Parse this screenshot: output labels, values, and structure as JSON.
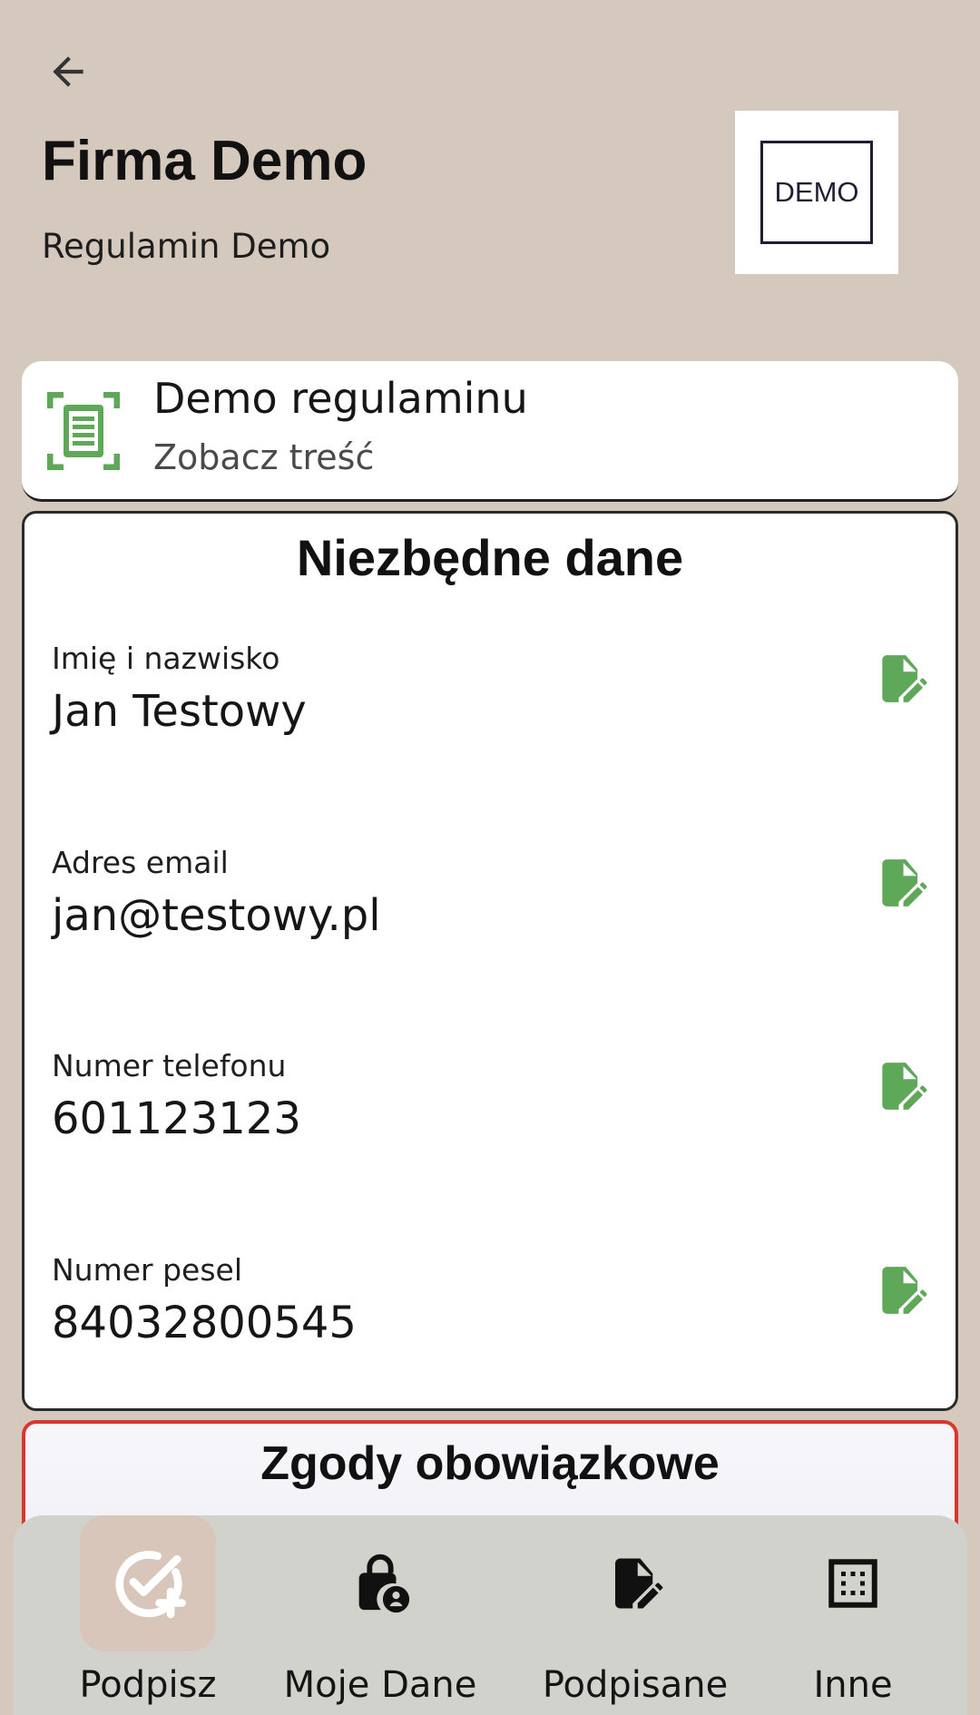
{
  "header": {
    "company_name": "Firma Demo",
    "document_name": "Regulamin Demo",
    "logo_text": "DEMO"
  },
  "regulation_card": {
    "title": "Demo regulaminu",
    "subtitle": "Zobacz treść"
  },
  "required_data": {
    "title": "Niezbędne dane",
    "fields": [
      {
        "label": "Imię i nazwisko",
        "value": "Jan Testowy"
      },
      {
        "label": "Adres email",
        "value": "jan@testowy.pl"
      },
      {
        "label": "Numer telefonu",
        "value": "601123123"
      },
      {
        "label": "Numer pesel",
        "value": "84032800545"
      }
    ]
  },
  "consents": {
    "title": "Zgody obowiązkowe"
  },
  "bottom_nav": {
    "items": [
      {
        "label": "Podpisz",
        "icon": "check-circle-plus-icon",
        "active": true
      },
      {
        "label": "Moje Dane",
        "icon": "lock-person-icon",
        "active": false
      },
      {
        "label": "Podpisane",
        "icon": "document-edit-icon",
        "active": false
      },
      {
        "label": "Inne",
        "icon": "grid-dots-icon",
        "active": false
      }
    ]
  },
  "colors": {
    "background": "#d5c9be",
    "accent_green": "#5fa85a",
    "consent_border": "#d8372f",
    "nav_background": "#d1d2cc",
    "nav_active": "#d8c6bb"
  }
}
